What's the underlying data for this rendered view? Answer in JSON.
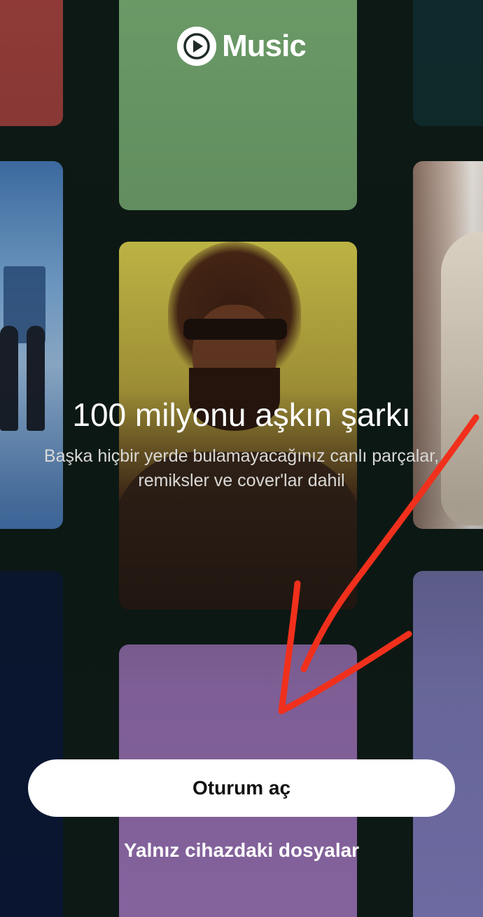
{
  "logo": {
    "brand_text": "Music",
    "icon": "play-circle-icon"
  },
  "onboarding": {
    "headline": "100 milyonu aşkın şarkı",
    "subtext": "Başka hiçbir yerde bulamayacağınız canlı parçalar,\nremiksler ve cover'lar dahil"
  },
  "actions": {
    "sign_in_label": "Oturum aç",
    "local_files_label": "Yalnız cihazdaki dosyalar"
  },
  "colors": {
    "annotation_arrow": "#f0301c",
    "tile_green": "#6a9966",
    "tile_purple": "#84629c",
    "tile_red": "#8f3a37"
  }
}
